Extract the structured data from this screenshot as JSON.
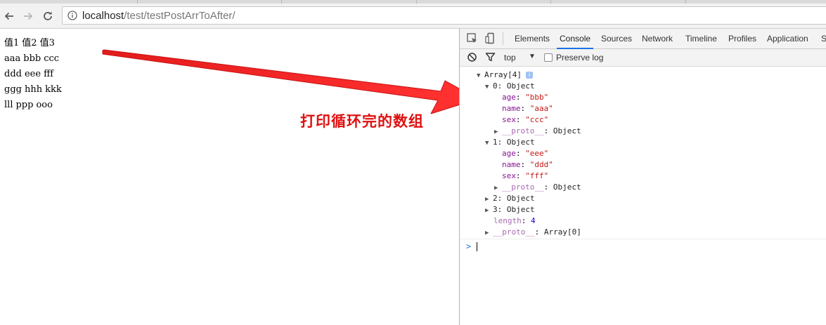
{
  "browser": {
    "url_host": "localhost",
    "url_path": "/test/testPostArrToAfter/"
  },
  "page": {
    "rows": [
      [
        "值1",
        "值2",
        "值3"
      ],
      [
        "aaa",
        "bbb",
        "ccc"
      ],
      [
        "ddd",
        "eee",
        "fff"
      ],
      [
        "ggg",
        "hhh",
        "kkk"
      ],
      [
        "lll",
        "ppp",
        "ooo"
      ]
    ],
    "annotation": "打印循环完的数组",
    "annotation_color": "#e01010"
  },
  "devtools": {
    "tabs": [
      "Elements",
      "Console",
      "Sources",
      "Network",
      "Timeline",
      "Profiles",
      "Application",
      "Se"
    ],
    "active_tab": "Console",
    "context": "top",
    "preserve_log_label": "Preserve log",
    "preserve_log_checked": false,
    "console": {
      "array_label": "Array[4]",
      "item0": {
        "label": "0: Object",
        "props": [
          {
            "key": "age",
            "value": "\"bbb\""
          },
          {
            "key": "name",
            "value": "\"aaa\""
          },
          {
            "key": "sex",
            "value": "\"ccc\""
          }
        ],
        "proto_key": "__proto__",
        "proto_value": "Object"
      },
      "item1": {
        "label": "1: Object",
        "props": [
          {
            "key": "age",
            "value": "\"eee\""
          },
          {
            "key": "name",
            "value": "\"ddd\""
          },
          {
            "key": "sex",
            "value": "\"fff\""
          }
        ],
        "proto_key": "__proto__",
        "proto_value": "Object"
      },
      "item2_label": "2: Object",
      "item3_label": "3: Object",
      "length_key": "length",
      "length_value": "4",
      "array_proto_key": "__proto__",
      "array_proto_value": "Array[0]",
      "prompt": ">"
    }
  }
}
